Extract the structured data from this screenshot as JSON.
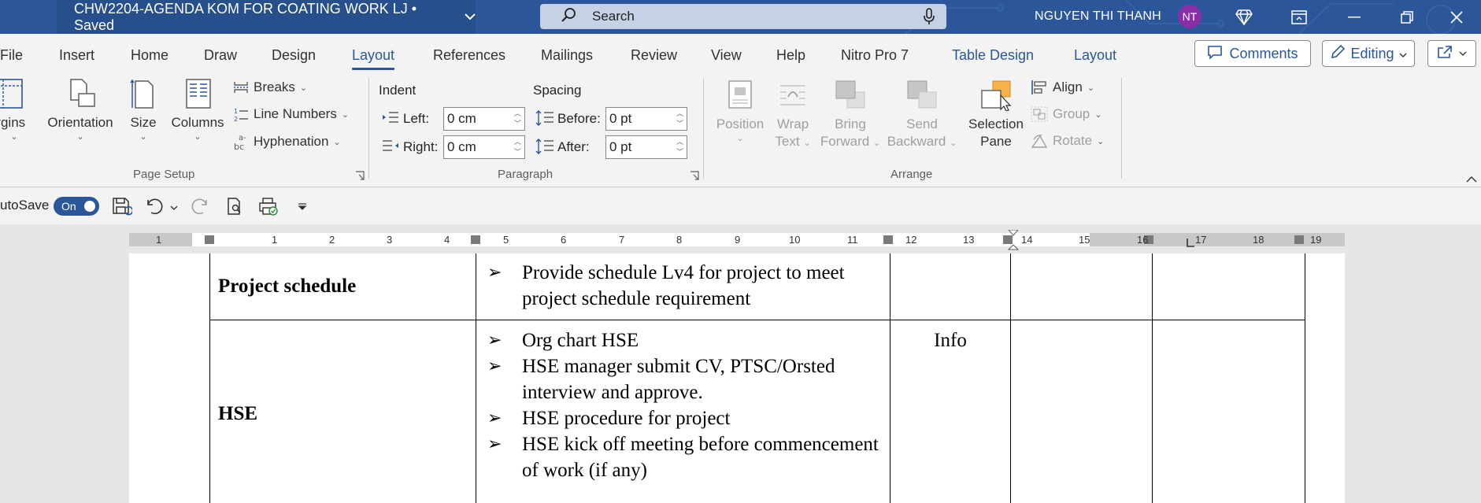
{
  "titlebar": {
    "doc_title": "CHW2204-AGENDA KOM FOR COATING WORK LJ • Saved",
    "search_placeholder": "Search",
    "user_name": "NGUYEN THI THANH",
    "user_initials": "NT"
  },
  "menu": {
    "tabs": [
      "File",
      "Insert",
      "Home",
      "Draw",
      "Design",
      "Layout",
      "References",
      "Mailings",
      "Review",
      "View",
      "Help",
      "Nitro Pro 7",
      "Table Design",
      "Layout"
    ],
    "active_tab": "Layout",
    "comments_label": "Comments",
    "editing_label": "Editing"
  },
  "ribbon": {
    "page_setup": {
      "margins": "argins",
      "orientation": "Orientation",
      "size": "Size",
      "columns": "Columns",
      "breaks": "Breaks",
      "line_numbers": "Line Numbers",
      "hyphenation": "Hyphenation",
      "group_label": "Page Setup"
    },
    "paragraph": {
      "indent_label": "Indent",
      "spacing_label": "Spacing",
      "left_label": "Left:",
      "right_label": "Right:",
      "before_label": "Before:",
      "after_label": "After:",
      "left_value": "0 cm",
      "right_value": "0 cm",
      "before_value": "0 pt",
      "after_value": "0 pt",
      "group_label": "Paragraph"
    },
    "arrange": {
      "position": "Position",
      "wrap_text_1": "Wrap",
      "wrap_text_2": "Text",
      "bring_forward_1": "Bring",
      "bring_forward_2": "Forward",
      "send_backward_1": "Send",
      "send_backward_2": "Backward",
      "selection_pane_1": "Selection",
      "selection_pane_2": "Pane",
      "align": "Align",
      "group": "Group",
      "rotate": "Rotate",
      "group_label": "Arrange"
    }
  },
  "qat": {
    "autosave_label": "utoSave",
    "toggle_label": "On"
  },
  "ruler": {
    "numbers": [
      "1",
      "1",
      "2",
      "3",
      "4",
      "5",
      "6",
      "7",
      "8",
      "9",
      "10",
      "11",
      "12",
      "13",
      "14",
      "15",
      "16",
      "17",
      "18",
      "19"
    ]
  },
  "document": {
    "rows": [
      {
        "topic": "Project schedule",
        "bullets": [
          "Provide schedule Lv4 for project to meet project schedule requirement"
        ],
        "note": ""
      },
      {
        "topic": "HSE",
        "bullets": [
          "Org chart HSE",
          "HSE manager submit CV, PTSC/Orsted interview and approve.",
          "HSE procedure for project",
          "HSE kick off meeting before commencement of work (if any)"
        ],
        "note": "Info"
      }
    ]
  },
  "colors": {
    "title_bar": "#2b579a",
    "accent": "#2b579a",
    "ribbon_bg": "#f3f3f3",
    "avatar": "#8a2ea8"
  }
}
